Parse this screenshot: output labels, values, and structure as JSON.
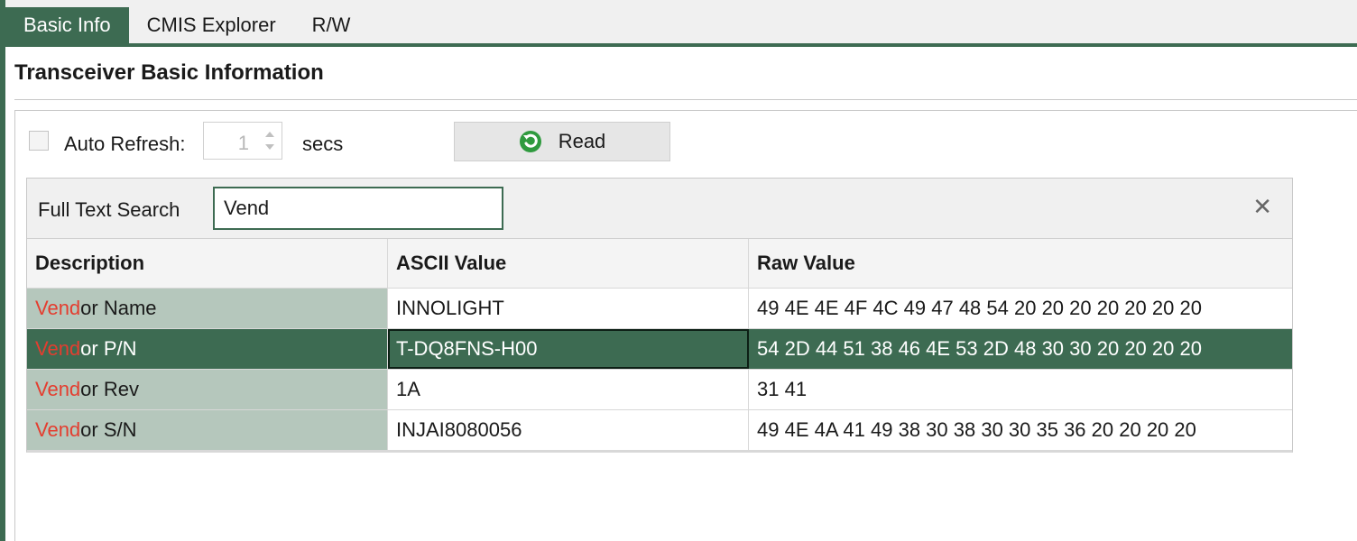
{
  "tabs": [
    {
      "label": "Basic Info",
      "active": true
    },
    {
      "label": "CMIS Explorer",
      "active": false
    },
    {
      "label": "R/W",
      "active": false
    }
  ],
  "section_title": "Transceiver Basic Information",
  "controls": {
    "auto_refresh_label": "Auto Refresh:",
    "auto_refresh_checked": false,
    "interval_value": "1",
    "secs_label": "secs",
    "read_button_label": "Read",
    "read_icon": "refresh-icon"
  },
  "search": {
    "label": "Full Text Search",
    "value": "Vend",
    "clear_icon": "close-icon"
  },
  "table": {
    "columns": [
      "Description",
      "ASCII Value",
      "Raw Value"
    ],
    "rows": [
      {
        "desc_match": "Vend",
        "desc_rest": "or Name",
        "ascii": "INNOLIGHT",
        "raw": "49 4E 4E 4F 4C 49 47 48 54 20 20 20 20 20 20 20",
        "selected": false
      },
      {
        "desc_match": "Vend",
        "desc_rest": "or P/N",
        "ascii": "T-DQ8FNS-H00",
        "raw": "54 2D 44 51 38 46 4E 53 2D 48 30 30 20 20 20 20",
        "selected": true
      },
      {
        "desc_match": "Vend",
        "desc_rest": "or Rev",
        "ascii": "1A",
        "raw": "31 41",
        "selected": false
      },
      {
        "desc_match": "Vend",
        "desc_rest": "or S/N",
        "ascii": "INJAI8080056",
        "raw": "49 4E 4A 41 49 38 30 38 30 30 35 36 20 20 20 20",
        "selected": false
      }
    ]
  },
  "colors": {
    "accent": "#3d6b52",
    "match_highlight": "#e43d2f",
    "desc_column_bg": "#b5c7bc"
  }
}
